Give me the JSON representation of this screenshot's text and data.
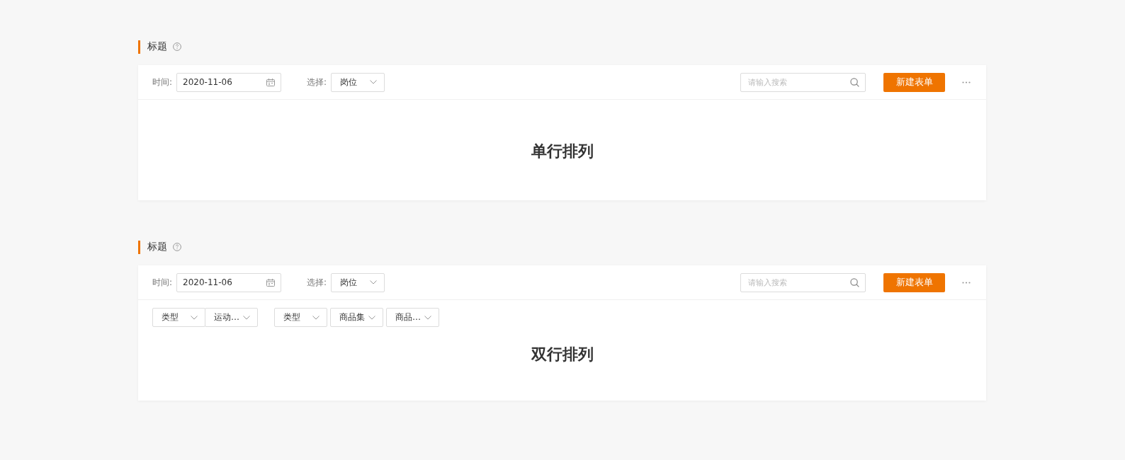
{
  "sections": [
    {
      "title": "标题",
      "toolbar": {
        "filters": [
          {
            "kind": "date",
            "label": "时间:",
            "value": "2020-11-06"
          },
          {
            "kind": "select",
            "label": "选择:",
            "value": "岗位"
          }
        ],
        "search": {
          "placeholder": "请输入搜索"
        },
        "primary_button": "新建表单"
      },
      "content_label": "单行排列"
    },
    {
      "title": "标题",
      "toolbar": {
        "filters": [
          {
            "kind": "date",
            "label": "时间:",
            "value": "2020-11-06"
          },
          {
            "kind": "select",
            "label": "选择:",
            "value": "岗位"
          }
        ],
        "search": {
          "placeholder": "请输入搜索"
        },
        "primary_button": "新建表单"
      },
      "filter_groups": [
        {
          "kind": "joined",
          "items": [
            "类型",
            "运动…"
          ]
        },
        {
          "kind": "separate",
          "items": [
            "类型",
            "商品集",
            "商品…"
          ]
        }
      ],
      "content_label": "双行排列"
    }
  ]
}
